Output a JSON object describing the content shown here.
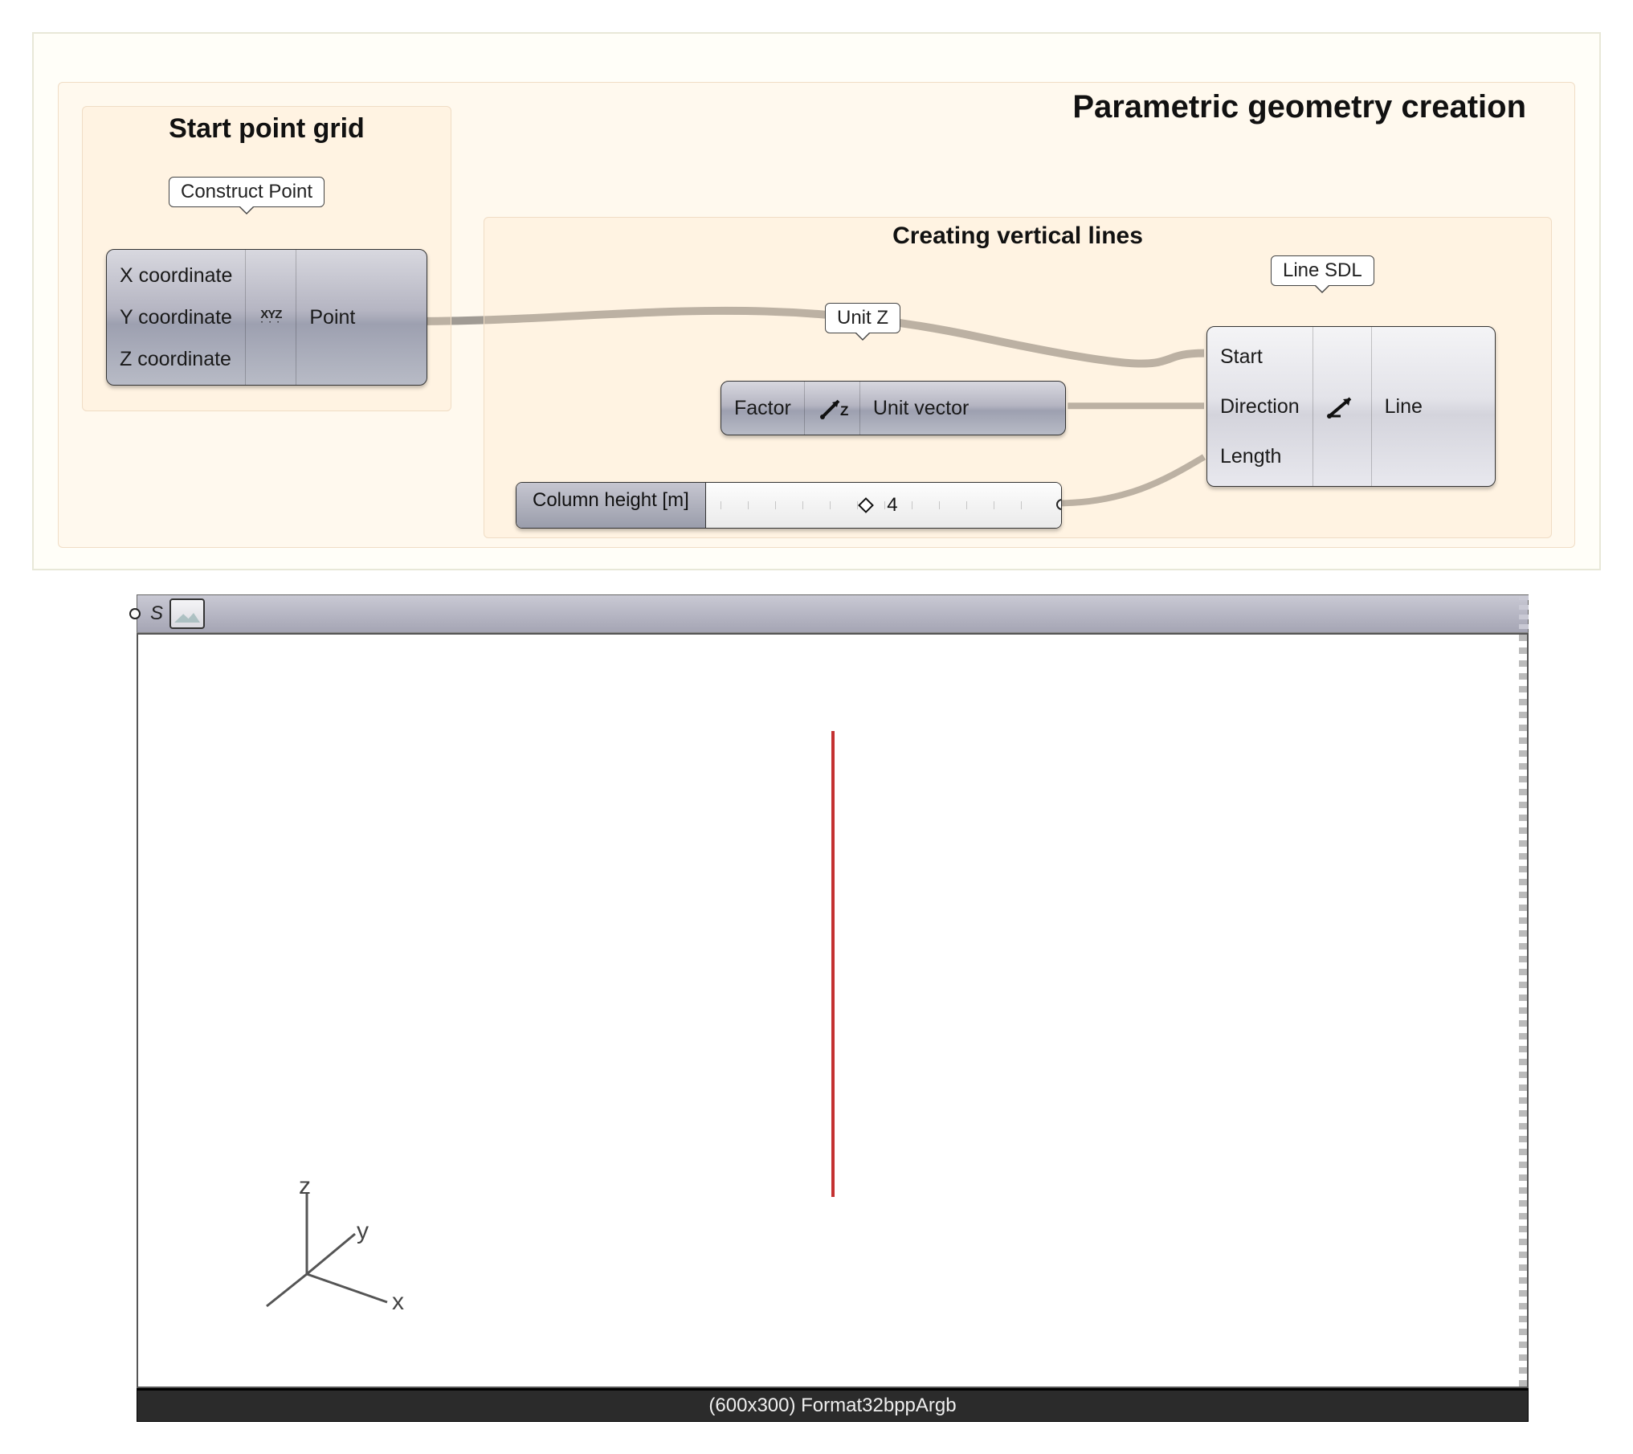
{
  "groups": {
    "outer_title": "Parametric geometry creation",
    "start_grid": {
      "title": "Start point grid",
      "scribble": "Construct Point"
    },
    "vertical": {
      "title": "Creating vertical lines",
      "scribble_unitz": "Unit Z",
      "scribble_linesdl": "Line SDL"
    }
  },
  "nodes": {
    "construct_point": {
      "inputs": [
        "X coordinate",
        "Y coordinate",
        "Z coordinate"
      ],
      "icon": "XYZ",
      "outputs": [
        "Point"
      ]
    },
    "unit_z": {
      "inputs": [
        "Factor"
      ],
      "icon": "Z",
      "outputs": [
        "Unit vector"
      ]
    },
    "line_sdl": {
      "inputs": [
        "Start",
        "Direction",
        "Length"
      ],
      "icon": "arrow",
      "outputs": [
        "Line"
      ]
    },
    "slider": {
      "label": "Column height [m]",
      "value": "4"
    }
  },
  "viewport": {
    "tag": "S",
    "axes": {
      "x": "x",
      "y": "y",
      "z": "z"
    },
    "status": "(600x300) Format32bppArgb"
  }
}
